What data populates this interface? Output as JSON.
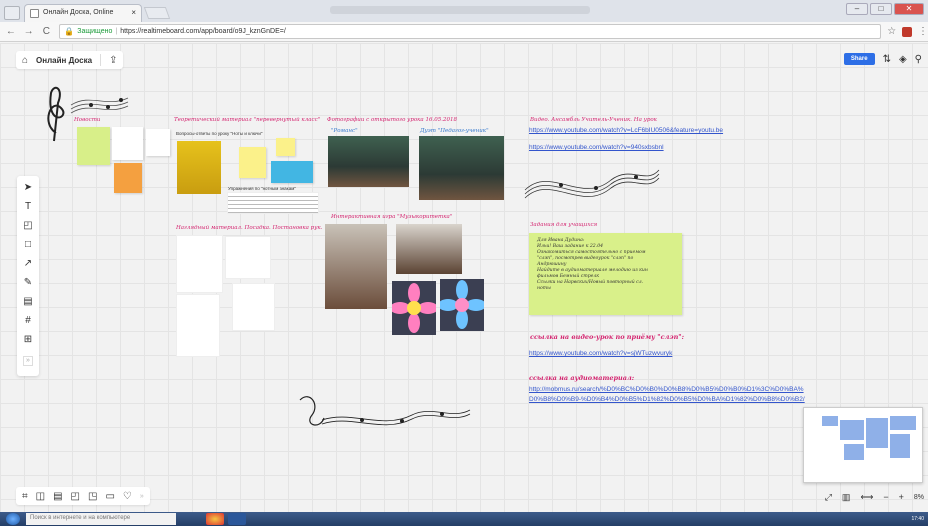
{
  "browser": {
    "tab_title": "Онлайн Доска, Online",
    "tab_close": "×",
    "url_secure_label": "Защищено",
    "url": "https://realtimeboard.com/app/board/o9J_kznGnDE=/"
  },
  "board": {
    "name": "Онлайн Доска",
    "share_label": "Share"
  },
  "sections": {
    "novosti": "Новости",
    "theory": "Теоретический материал \"перевернутый класс\"",
    "theory_caption": "Вопросы-ответы по уроку \"Ноты и ключи\"",
    "theory_caption2": "Упражнения по \"нотным знакам\"",
    "photos": "Фотографии с открытого урока 16.05.2018",
    "romance": "\"Романс\"",
    "duet": "Дуэт \"Педагог-ученик\"",
    "interactive": "Интерактивная игра \"Музыкоритетка\"",
    "visual": "Наглядный материал. Посадка. Постановка рук.",
    "video": "Видео. Ансамбль Учитель-Ученик. На урок",
    "tasks": "Задания для учащихся",
    "video_lesson": "ссылка на видео-урок по приёму \"слэп\":",
    "audio": "ссылка на аудиоматериал:"
  },
  "links": {
    "video1": "https://www.youtube.com/watch?v=LcF6bIU0506&feature=youtu.be",
    "video2": "https://www.youtube.com/watch?v=940sxbsbnl",
    "slap": "https://www.youtube.com/watch?v=sjWTuzwvuryk",
    "audio1": "http://mobmus.ru/search/%D0%BC%D0%B0%D0%B8%D0%B5%D0%B0%D1%3C%D0%BA%",
    "audio2": "D0%B8%D0%B9-%D0%B4%D0%B5%D1%82%D0%B5%D0%BA%D1%82%D0%B8%D0%B2/"
  },
  "tasks_note": [
    "Для Ивана Дудина:",
    "Ильи! Ваш задание к 22.04",
    "Ознакомиться самостоятельно с приемом",
    "\"слэп\", посмотрев видеоурок \"слэп\" по",
    "Андрюшину",
    "Найдите в аудиоматериале мелодию из кин",
    "фильмов Бемный стрелк",
    "Ссылки на Нарвских/Новый повторный сл.",
    "ноты"
  ],
  "taskbar": {
    "search_placeholder": "Поиск в интернете и на компьютере",
    "clock": "17:40"
  },
  "zoom": "8%"
}
